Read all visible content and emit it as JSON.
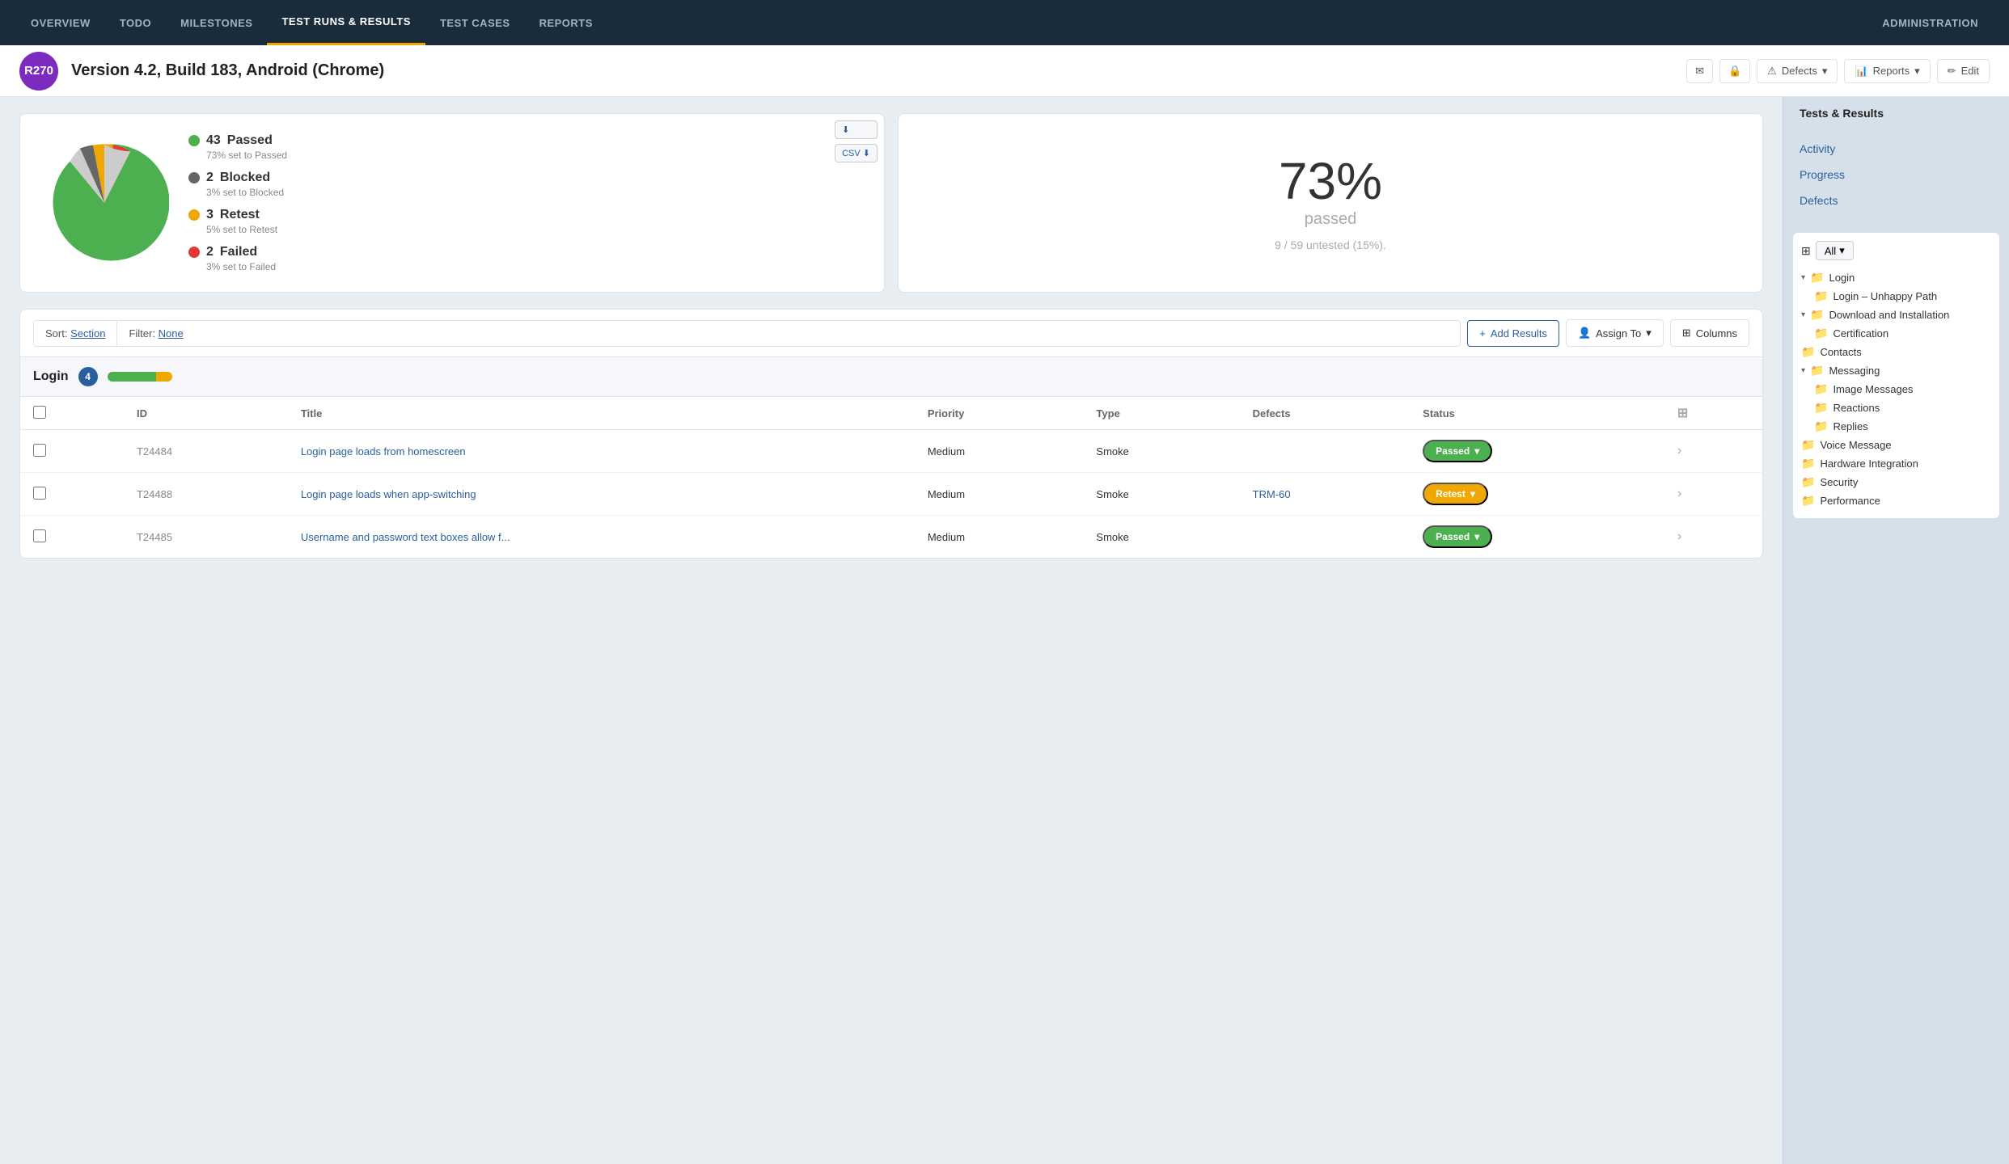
{
  "nav": {
    "items": [
      {
        "id": "overview",
        "label": "OVERVIEW",
        "active": false
      },
      {
        "id": "todo",
        "label": "TODO",
        "active": false
      },
      {
        "id": "milestones",
        "label": "MILESTONES",
        "active": false
      },
      {
        "id": "test-runs",
        "label": "TEST RUNS & RESULTS",
        "active": true
      },
      {
        "id": "test-cases",
        "label": "TEST CASES",
        "active": false
      },
      {
        "id": "reports",
        "label": "REPORTS",
        "active": false
      },
      {
        "id": "administration",
        "label": "ADMINISTRATION",
        "active": false
      }
    ]
  },
  "run": {
    "badge": "R270",
    "title": "Version 4.2, Build 183, Android (Chrome)",
    "actions": {
      "defects_label": "Defects",
      "reports_label": "Reports",
      "edit_label": "Edit"
    }
  },
  "right_sidebar": {
    "title": "Tests & Results",
    "nav_items": [
      {
        "id": "activity",
        "label": "Activity"
      },
      {
        "id": "progress",
        "label": "Progress"
      },
      {
        "id": "defects",
        "label": "Defects"
      }
    ],
    "filter_label": "All",
    "tree": [
      {
        "id": "login",
        "label": "Login",
        "indent": 0,
        "has_arrow": true
      },
      {
        "id": "login-unhappy",
        "label": "Login – Unhappy Path",
        "indent": 1
      },
      {
        "id": "download",
        "label": "Download and Installation",
        "indent": 0,
        "has_arrow": true
      },
      {
        "id": "certification",
        "label": "Certification",
        "indent": 1
      },
      {
        "id": "contacts",
        "label": "Contacts",
        "indent": 0
      },
      {
        "id": "messaging",
        "label": "Messaging",
        "indent": 0,
        "has_arrow": true
      },
      {
        "id": "image-messages",
        "label": "Image Messages",
        "indent": 1
      },
      {
        "id": "reactions",
        "label": "Reactions",
        "indent": 1
      },
      {
        "id": "replies",
        "label": "Replies",
        "indent": 1
      },
      {
        "id": "voice-message",
        "label": "Voice Message",
        "indent": 0
      },
      {
        "id": "hardware-integration",
        "label": "Hardware Integration",
        "indent": 0
      },
      {
        "id": "security",
        "label": "Security",
        "indent": 0
      },
      {
        "id": "performance",
        "label": "Performance",
        "indent": 0
      }
    ]
  },
  "stats": {
    "passed_count": "43",
    "passed_label": "Passed",
    "passed_pct": "73% set to Passed",
    "blocked_count": "2",
    "blocked_label": "Blocked",
    "blocked_pct": "3% set to Blocked",
    "retest_count": "3",
    "retest_label": "Retest",
    "retest_pct": "5% set to Retest",
    "failed_count": "2",
    "failed_label": "Failed",
    "failed_pct": "3% set to Failed",
    "percent": "73%",
    "percent_label": "passed",
    "untested": "9 / 59 untested (15%)."
  },
  "toolbar": {
    "sort_label": "Sort:",
    "sort_value": "Section",
    "filter_label": "Filter:",
    "filter_value": "None",
    "add_results": "+ Add Results",
    "assign_to": "Assign To",
    "columns": "Columns"
  },
  "section": {
    "title": "Login",
    "count": "4"
  },
  "table": {
    "headers": [
      "",
      "ID",
      "Title",
      "Priority",
      "Type",
      "Defects",
      "Status",
      ""
    ],
    "rows": [
      {
        "id": "T24484",
        "title": "Login page loads from homescreen",
        "priority": "Medium",
        "type": "Smoke",
        "defects": "",
        "status": "Passed",
        "status_class": "passed"
      },
      {
        "id": "T24488",
        "title": "Login page loads when app-switching",
        "priority": "Medium",
        "type": "Smoke",
        "defects": "TRM-60",
        "status": "Retest",
        "status_class": "retest"
      },
      {
        "id": "T24485",
        "title": "Username and password text boxes allow f...",
        "priority": "Medium",
        "type": "Smoke",
        "defects": "",
        "status": "Passed",
        "status_class": "passed"
      }
    ]
  },
  "colors": {
    "passed": "#4caf50",
    "blocked": "#666666",
    "retest": "#f0a800",
    "failed": "#e53935",
    "accent": "#2a5f9e"
  }
}
